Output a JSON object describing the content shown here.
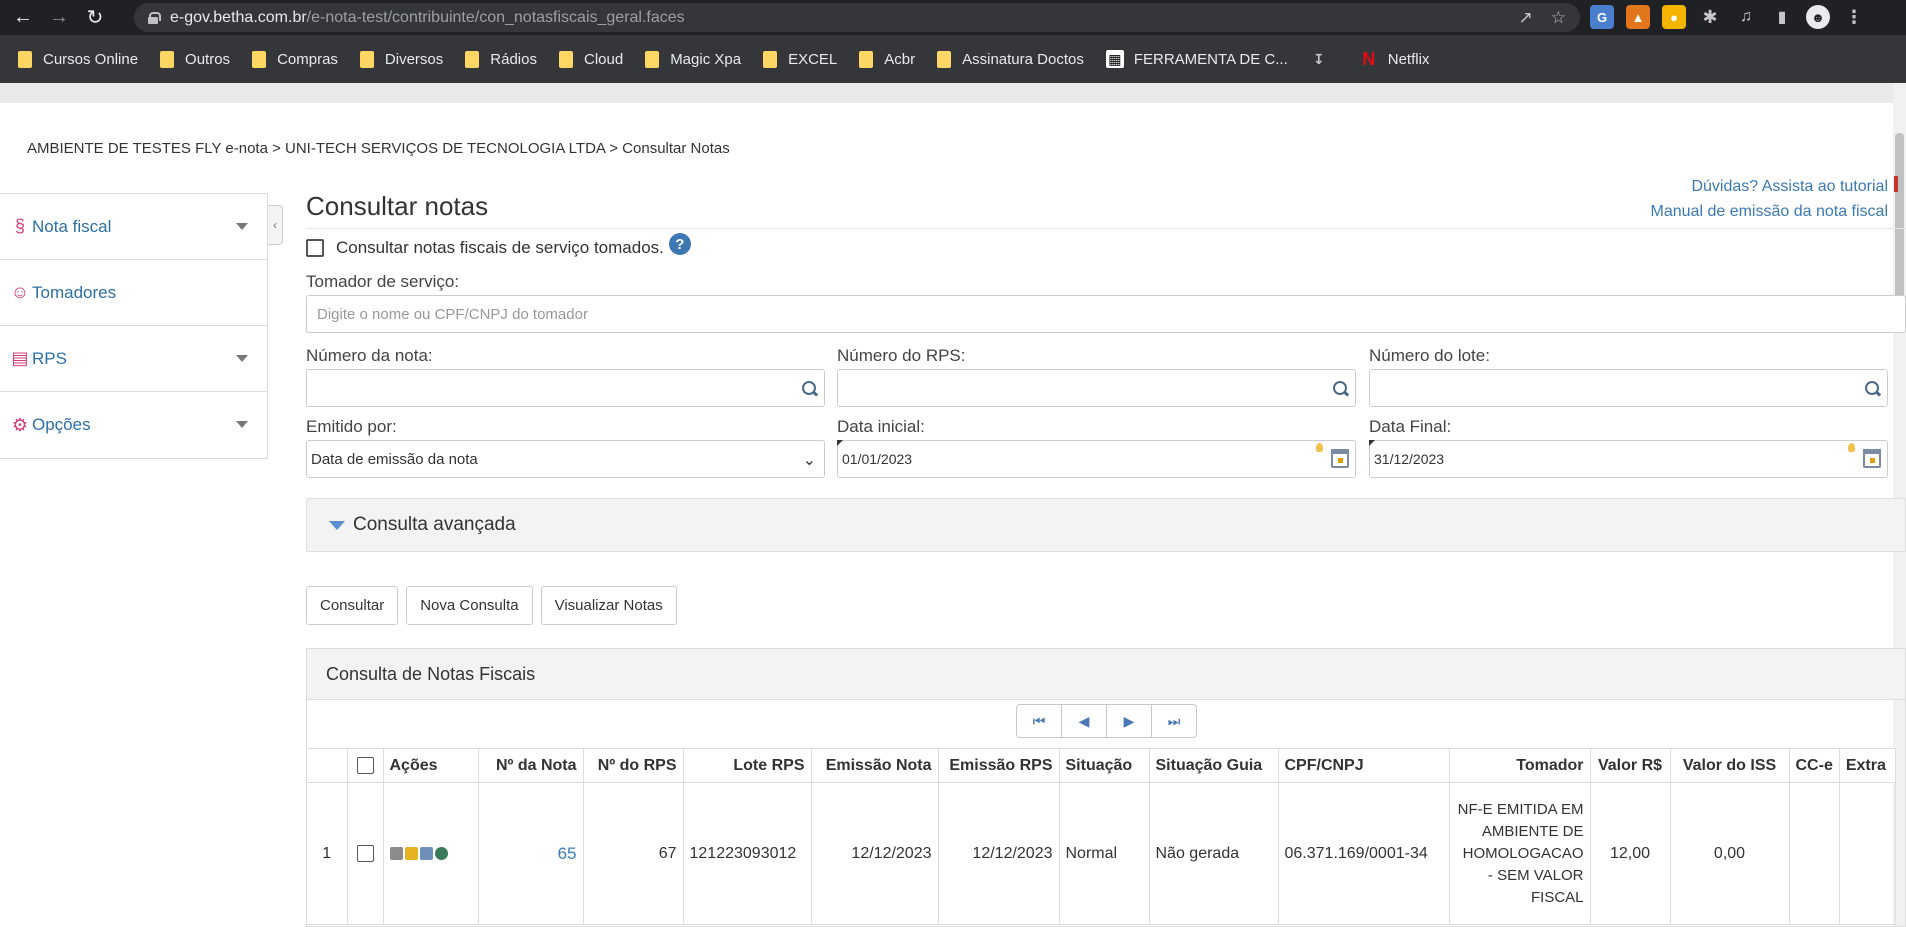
{
  "browser": {
    "url_host": "e-gov.betha.com.br",
    "url_path": "/e-nota-test/contribuinte/con_notasfiscais_geral.faces",
    "bookmarks": [
      "Cursos Online",
      "Outros",
      "Compras",
      "Diversos",
      "Rádios",
      "Cloud",
      "Magic Xpa",
      "EXCEL",
      "Acbr",
      "Assinatura Doctos",
      "FERRAMENTA DE C...",
      "Netflix"
    ]
  },
  "breadcrumb": "AMBIENTE DE TESTES FLY e-nota > UNI-TECH SERVIÇOS DE TECNOLOGIA LTDA > Consultar Notas",
  "sidebar": {
    "items": [
      {
        "label": "Nota fiscal",
        "icon": "nota-fiscal-icon"
      },
      {
        "label": "Tomadores",
        "icon": "user-icon"
      },
      {
        "label": "RPS",
        "icon": "document-icon"
      },
      {
        "label": "Opções",
        "icon": "gear-icon"
      }
    ]
  },
  "page": {
    "title": "Consultar notas",
    "help_link_1": "Dúvidas? Assista ao tutorial",
    "help_link_2": "Manual de emissão da nota fiscal"
  },
  "form": {
    "checkbox_label": "Consultar notas fiscais de serviço tomados.",
    "tomador_label": "Tomador de serviço:",
    "tomador_placeholder": "Digite o nome ou CPF/CNPJ do tomador",
    "numero_nota_label": "Número da nota:",
    "numero_rps_label": "Número do RPS:",
    "numero_lote_label": "Número do lote:",
    "emitido_por_label": "Emitido por:",
    "emitido_por_value": "Data de emissão da nota",
    "data_inicial_label": "Data inicial:",
    "data_inicial_value": "01/01/2023",
    "data_final_label": "Data Final:",
    "data_final_value": "31/12/2023",
    "advanced_label": "Consulta avançada"
  },
  "buttons": {
    "consultar": "Consultar",
    "nova_consulta": "Nova Consulta",
    "visualizar": "Visualizar Notas"
  },
  "results": {
    "title": "Consulta de Notas Fiscais",
    "columns": [
      "Ações",
      "Nº da Nota",
      "Nº do RPS",
      "Lote RPS",
      "Emissão Nota",
      "Emissão RPS",
      "Situação",
      "Situação Guia",
      "CPF/CNPJ",
      "Tomador",
      "Valor R$",
      "Valor do ISS",
      "CC-e",
      "Extra"
    ],
    "rows": [
      {
        "index": "1",
        "numero_nota": "65",
        "numero_rps": "67",
        "lote_rps": "121223093012",
        "emissao_nota": "12/12/2023",
        "emissao_rps": "12/12/2023",
        "situacao": "Normal",
        "situacao_guia": "Não gerada",
        "cpf_cnpj": "06.371.169/0001-34",
        "tomador": "NF-E EMITIDA EM AMBIENTE DE HOMOLOGACAO - SEM VALOR FISCAL",
        "valor": "12,00",
        "valor_iss": "0,00",
        "cce": "",
        "extra": ""
      }
    ]
  }
}
